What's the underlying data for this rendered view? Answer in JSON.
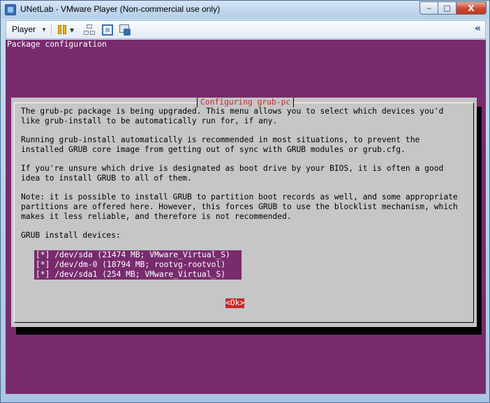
{
  "window": {
    "title": "UNetLab - VMware Player (Non-commercial use only)",
    "controls": {
      "minimize": "‒",
      "maximize": "□",
      "close": "X"
    }
  },
  "toolbar": {
    "player_label": "Player",
    "icons": [
      "pause-icon",
      "network-icon",
      "fullscreen-icon",
      "unity-icon",
      "collapse-icon"
    ],
    "collapse_glyph": "«"
  },
  "console": {
    "header": "Package configuration",
    "background_color": "#782c6e",
    "dialog": {
      "title": "Configuring grub-pc",
      "paragraphs": [
        "The grub-pc package is being upgraded. This menu allows you to select which devices you'd\nlike grub-install to be automatically run for, if any.",
        "Running grub-install automatically is recommended in most situations, to prevent the\ninstalled GRUB core image from getting out of sync with GRUB modules or grub.cfg.",
        "If you're unsure which drive is designated as boot drive by your BIOS, it is often a good\nidea to install GRUB to all of them.",
        "Note: it is possible to install GRUB to partition boot records as well, and some appropriate\npartitions are offered here. However, this forces GRUB to use the blocklist mechanism, which\nmakes it less reliable, and therefore is not recommended.",
        "GRUB install devices:"
      ],
      "devices": [
        {
          "checked": true,
          "label": "[*] /dev/sda (21474 MB; VMware_Virtual_S)"
        },
        {
          "checked": true,
          "label": "[*] /dev/dm-0 (18794 MB; rootvg-rootvol)"
        },
        {
          "checked": true,
          "label": "[*] /dev/sda1 (254 MB; VMware_Virtual_S)"
        }
      ],
      "ok_label": "<Ok>"
    }
  }
}
